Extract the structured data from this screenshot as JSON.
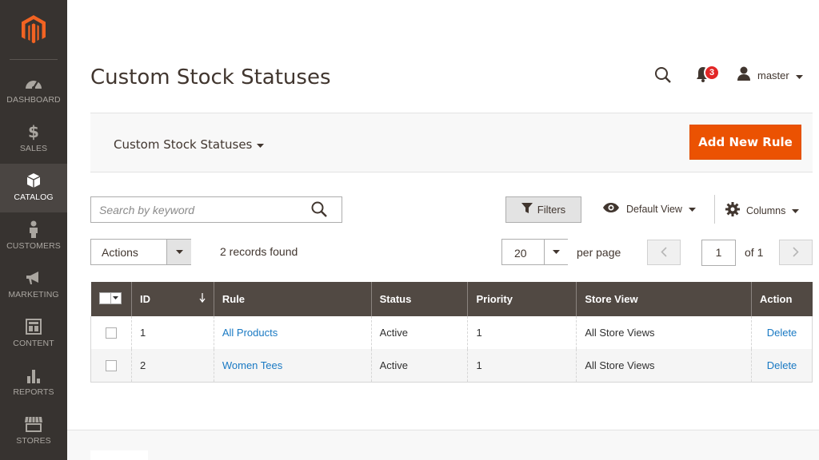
{
  "sidebar": {
    "items": [
      {
        "label": "DASHBOARD",
        "icon": "dashboard-icon"
      },
      {
        "label": "SALES",
        "icon": "dollar-icon"
      },
      {
        "label": "CATALOG",
        "icon": "cube-icon"
      },
      {
        "label": "CUSTOMERS",
        "icon": "person-icon"
      },
      {
        "label": "MARKETING",
        "icon": "megaphone-icon"
      },
      {
        "label": "CONTENT",
        "icon": "content-icon"
      },
      {
        "label": "REPORTS",
        "icon": "bar-chart-icon"
      },
      {
        "label": "STORES",
        "icon": "store-icon"
      }
    ],
    "active": "CATALOG"
  },
  "header": {
    "title": "Custom Stock Statuses",
    "notifications_count": "3",
    "user_name": "master"
  },
  "page_actions": {
    "switcher_label": "Custom Stock Statuses",
    "add_button": "Add New Rule"
  },
  "toolbar": {
    "search_placeholder": "Search by keyword",
    "filters_label": "Filters",
    "view_label": "Default View",
    "columns_label": "Columns",
    "actions_label": "Actions",
    "records_found": "2 records found",
    "per_page_value": "20",
    "per_page_label": "per page",
    "current_page": "1",
    "total_pages_label": "of 1"
  },
  "grid": {
    "columns": [
      "ID",
      "Rule",
      "Status",
      "Priority",
      "Store View",
      "Action"
    ],
    "rows": [
      {
        "id": "1",
        "rule": "All Products",
        "status": "Active",
        "priority": "1",
        "store_view": "All Store Views",
        "action": "Delete"
      },
      {
        "id": "2",
        "rule": "Women Tees",
        "status": "Active",
        "priority": "1",
        "store_view": "All Store Views",
        "action": "Delete"
      }
    ]
  },
  "colors": {
    "sidebar_bg": "#373330",
    "accent": "#eb5202",
    "grid_header": "#514943",
    "link": "#1979c3"
  }
}
